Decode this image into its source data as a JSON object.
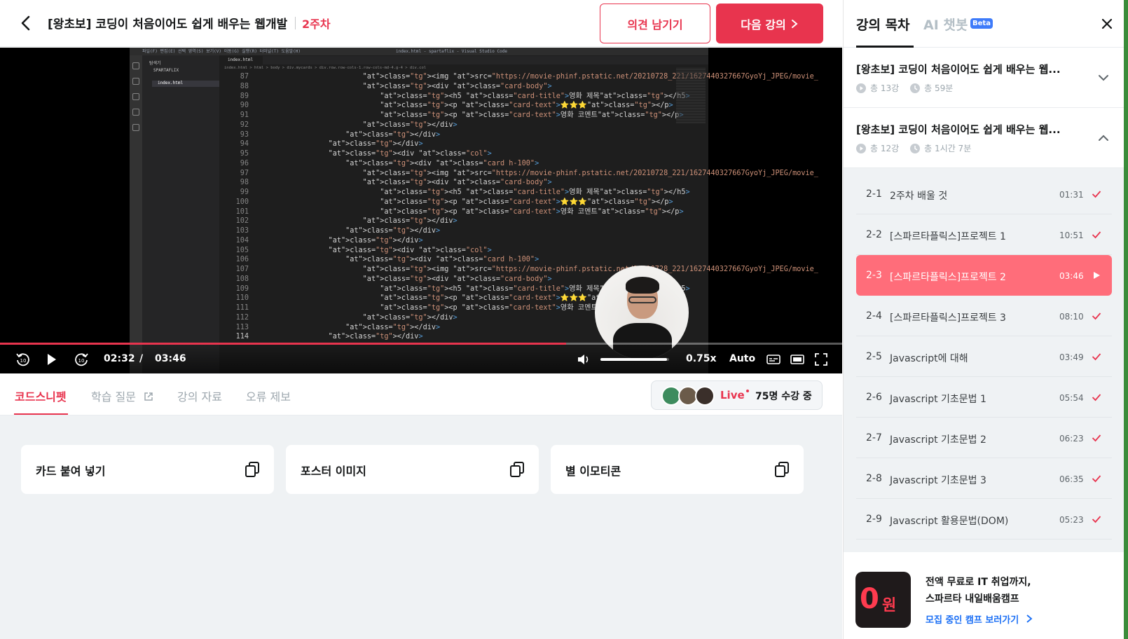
{
  "header": {
    "course_title": "[왕초보] 코딩이 처음이어도 쉽게 배우는 웹개발 ...",
    "week_label": "2주차",
    "feedback_label": "의견 남기기",
    "next_label": "다음 강의"
  },
  "player": {
    "current_time": "02:32",
    "separator": "/",
    "total_time": "03:46",
    "progress": 0.672,
    "volume": 0.97,
    "speed": "0.75x",
    "quality": "Auto"
  },
  "code_editor": {
    "menu": "파일(F)  편집(E)  선택 영역(S)  보기(V)  이동(G)  실행(R)  터미널(T)  도움말(H)",
    "window_title": "index.html - spartaflix - Visual Studio Code",
    "tab_name": "index.html",
    "explorer_title": "탐색기",
    "folder_name": "SPARTAFLIX",
    "file_name": "index.html",
    "breadcrumb": "index.html > html > body > div.mycards > div.row.row-cols-1.row-cols-md-4.g-4 > div.col",
    "lines": [
      {
        "n": "87",
        "indent": "                    ",
        "html": "<img src=\"https://movie-phinf.pstatic.net/20210728_221/1627440327667GyoYj_JPEG/movie_"
      },
      {
        "n": "88",
        "indent": "                    ",
        "html": "<div class=\"card-body\">"
      },
      {
        "n": "89",
        "indent": "                        ",
        "html": "<h5 class=\"card-title\">영화 제목</h5>"
      },
      {
        "n": "90",
        "indent": "                        ",
        "html": "<p class=\"card-text\">⭐⭐⭐</p>"
      },
      {
        "n": "91",
        "indent": "                        ",
        "html": "<p class=\"card-text\">영화 코멘트</p>"
      },
      {
        "n": "92",
        "indent": "                    ",
        "html": "</div>"
      },
      {
        "n": "93",
        "indent": "                ",
        "html": "</div>"
      },
      {
        "n": "94",
        "indent": "            ",
        "html": "</div>"
      },
      {
        "n": "95",
        "indent": "            ",
        "html": "<div class=\"col\">"
      },
      {
        "n": "96",
        "indent": "                ",
        "html": "<div class=\"card h-100\">"
      },
      {
        "n": "97",
        "indent": "                    ",
        "html": "<img src=\"https://movie-phinf.pstatic.net/20210728_221/1627440327667GyoYj_JPEG/movie_"
      },
      {
        "n": "98",
        "indent": "                    ",
        "html": "<div class=\"card-body\">"
      },
      {
        "n": "99",
        "indent": "                        ",
        "html": "<h5 class=\"card-title\">영화 제목</h5>"
      },
      {
        "n": "100",
        "indent": "                        ",
        "html": "<p class=\"card-text\">⭐⭐⭐</p>"
      },
      {
        "n": "101",
        "indent": "                        ",
        "html": "<p class=\"card-text\">영화 코멘트</p>"
      },
      {
        "n": "102",
        "indent": "                    ",
        "html": "</div>"
      },
      {
        "n": "103",
        "indent": "                ",
        "html": "</div>"
      },
      {
        "n": "104",
        "indent": "            ",
        "html": "</div>"
      },
      {
        "n": "105",
        "indent": "            ",
        "html": "<div class=\"col\">"
      },
      {
        "n": "106",
        "indent": "                ",
        "html": "<div class=\"card h-100\">"
      },
      {
        "n": "107",
        "indent": "                    ",
        "html": "<img src=\"https://movie-phinf.pstatic.net/20210728_221/1627440327667GyoYj_JPEG/movie_"
      },
      {
        "n": "108",
        "indent": "                    ",
        "html": "<div class=\"card-body\">"
      },
      {
        "n": "109",
        "indent": "                        ",
        "html": "<h5 class=\"card-title\">영화 제목</h5>"
      },
      {
        "n": "110",
        "indent": "                        ",
        "html": "<p class=\"card-text\">⭐⭐⭐</p>"
      },
      {
        "n": "111",
        "indent": "                        ",
        "html": "<p class=\"card-text\">영화 코멘트</p>"
      },
      {
        "n": "112",
        "indent": "                    ",
        "html": "</div>"
      },
      {
        "n": "113",
        "indent": "                ",
        "html": "</div>"
      },
      {
        "n": "114",
        "indent": "            ",
        "html": "</div>"
      }
    ]
  },
  "lecture_tabs": [
    {
      "label": "코드스니펫",
      "active": true
    },
    {
      "label": "학습 질문",
      "active": false
    },
    {
      "label": "강의 자료",
      "active": false
    },
    {
      "label": "오류 제보",
      "active": false
    }
  ],
  "live": {
    "label": "Live",
    "count": "75명 수강 중"
  },
  "snippets": [
    "카드 붙여 넣기",
    "포스터 이미지",
    "별 이모티콘"
  ],
  "sidebar": {
    "tab_toc": "강의 목차",
    "tab_ai": "AI 챗봇",
    "beta": "Beta",
    "chapters": [
      {
        "title": "[왕초보] 코딩이 처음이어도 쉽게 배우는 웹...",
        "lectures": "총 13강",
        "duration": "총 59분",
        "expanded": false
      },
      {
        "title": "[왕초보] 코딩이 처음이어도 쉽게 배우는 웹...",
        "lectures": "총 12강",
        "duration": "총 1시간 7분",
        "expanded": true
      }
    ],
    "lessons": [
      {
        "no": "2-1",
        "name": "2주차 배울 것",
        "time": "01:31",
        "status": "done"
      },
      {
        "no": "2-2",
        "name": "[스파르타플릭스]프로젝트 1",
        "time": "10:51",
        "status": "done"
      },
      {
        "no": "2-3",
        "name": "[스파르타플릭스]프로젝트 2",
        "time": "03:46",
        "status": "playing"
      },
      {
        "no": "2-4",
        "name": "[스파르타플릭스]프로젝트 3",
        "time": "08:10",
        "status": "done"
      },
      {
        "no": "2-5",
        "name": "Javascript에 대해",
        "time": "03:49",
        "status": "done"
      },
      {
        "no": "2-6",
        "name": "Javascript 기초문법 1",
        "time": "05:54",
        "status": "done"
      },
      {
        "no": "2-7",
        "name": "Javascript 기초문법 2",
        "time": "06:23",
        "status": "done"
      },
      {
        "no": "2-8",
        "name": "Javascript 기초문법 3",
        "time": "06:35",
        "status": "done"
      },
      {
        "no": "2-9",
        "name": "Javascript 활용문법(DOM)",
        "time": "05:23",
        "status": "done"
      }
    ],
    "promo": {
      "badge_big": "0",
      "badge_small": "원",
      "line1": "전액 무료로 IT 취업까지,",
      "line2": "스파르타 내일배움캠프",
      "link": "모집 중인 캠프 보러가기"
    }
  },
  "colors": {
    "accent": "#e8344e",
    "active_item": "#ff6d7a",
    "link": "#1b6ff5",
    "beta": "#3e7bfa"
  }
}
